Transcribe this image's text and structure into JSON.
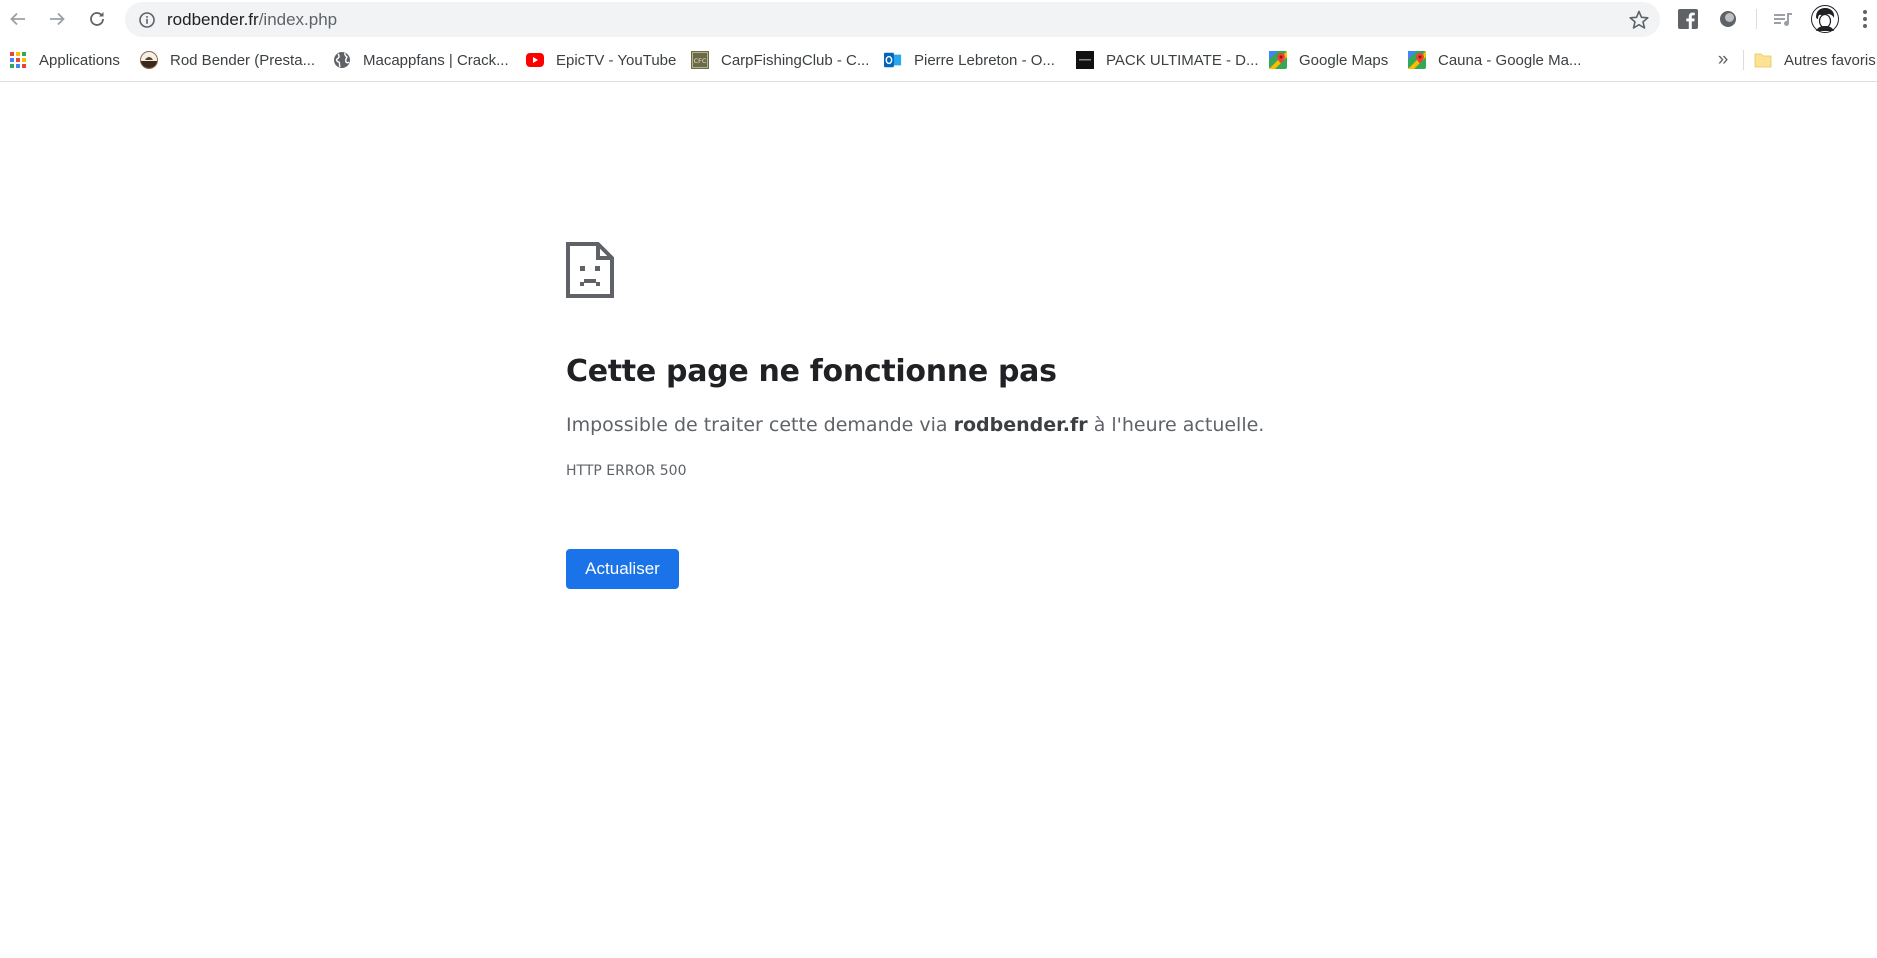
{
  "browser": {
    "url_host": "rodbender.fr",
    "url_path": "/index.php",
    "nav": {
      "back_icon": "arrow-left-icon",
      "forward_icon": "arrow-right-icon",
      "reload_icon": "reload-icon"
    },
    "extensions": [
      "facebook-icon",
      "circle-extension-icon",
      "media-queue-icon",
      "profile-avatar",
      "menu-dots-icon"
    ]
  },
  "bookmarks": {
    "items": [
      {
        "label": "Applications",
        "icon": "apps-grid-icon"
      },
      {
        "label": "Rod Bender (Presta...",
        "icon": "rod-bender-icon"
      },
      {
        "label": "Macappfans | Crack...",
        "icon": "globe-icon"
      },
      {
        "label": "EpicTV - YouTube",
        "icon": "youtube-icon"
      },
      {
        "label": "CarpFishingClub - C...",
        "icon": "cfc-icon"
      },
      {
        "label": "Pierre Lebreton - O...",
        "icon": "outlook-icon"
      },
      {
        "label": "PACK ULTIMATE - D...",
        "icon": "pack-ultimate-icon"
      },
      {
        "label": "Google Maps",
        "icon": "google-maps-icon"
      },
      {
        "label": "Cauna - Google Ma...",
        "icon": "google-maps-icon"
      }
    ],
    "overflow": "»",
    "other_folder": "Autres favoris"
  },
  "error": {
    "icon": "sad-page-icon",
    "title": "Cette page ne fonctionne pas",
    "desc_before": "Impossible de traiter cette demande via ",
    "desc_host": "rodbender.fr",
    "desc_after": " à l'heure actuelle.",
    "code": "HTTP ERROR 500",
    "button": "Actualiser"
  },
  "colors": {
    "accent": "#1a73e8",
    "omnibox_bg": "#f1f3f4",
    "muted_text": "#5f6368"
  }
}
